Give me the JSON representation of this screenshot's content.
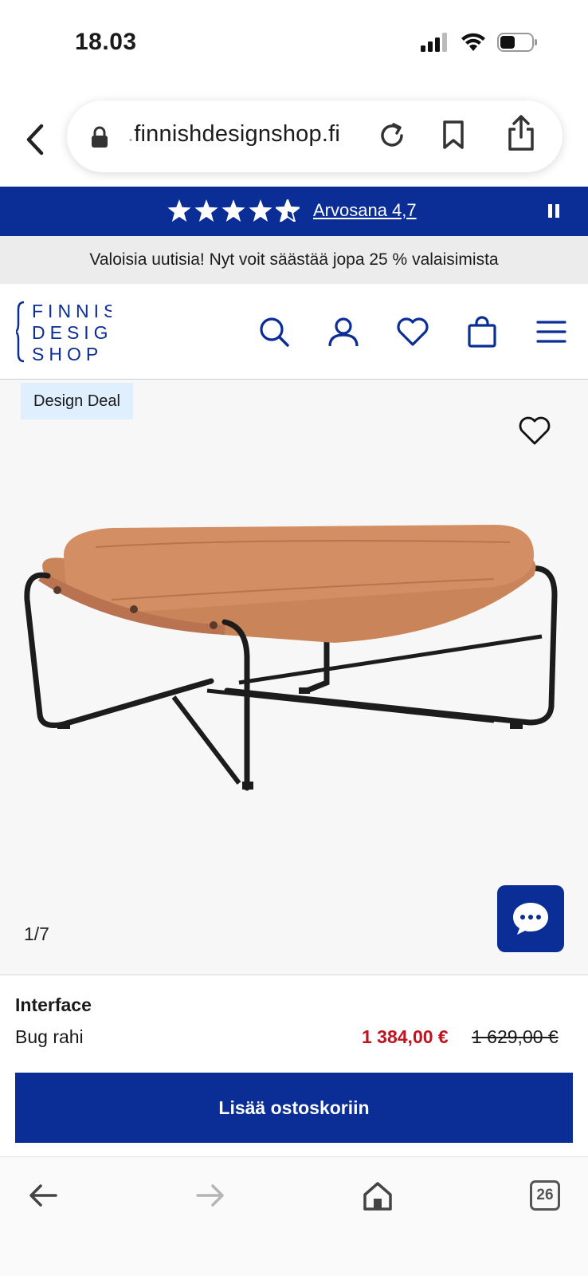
{
  "status_bar": {
    "time": "18.03"
  },
  "browser": {
    "url_prefix": ".",
    "url_host": "finnishdesignshop.fi"
  },
  "rating_banner": {
    "rating_label": "Arvosana 4,7",
    "rating_value": 4.7,
    "bg_color": "#0a2d96"
  },
  "promo": {
    "text": "Valoisia uutisia! Nyt voit säästää jopa 25 % valaisimista"
  },
  "header": {
    "logo_lines": [
      "FINNISH",
      "DESIGN",
      "SHOP"
    ],
    "icons": [
      "search-icon",
      "account-icon",
      "wishlist-icon",
      "cart-icon",
      "menu-icon"
    ]
  },
  "gallery": {
    "badge": "Design Deal",
    "counter": "1/7"
  },
  "product": {
    "brand": "Interface",
    "name": "Bug rahi",
    "sale_price": "1 384,00 €",
    "original_price": "1 629,00 €",
    "add_to_cart": "Lisää ostoskoriin",
    "sale_color": "#c1121f"
  },
  "bottom_nav": {
    "tab_count": "26"
  }
}
